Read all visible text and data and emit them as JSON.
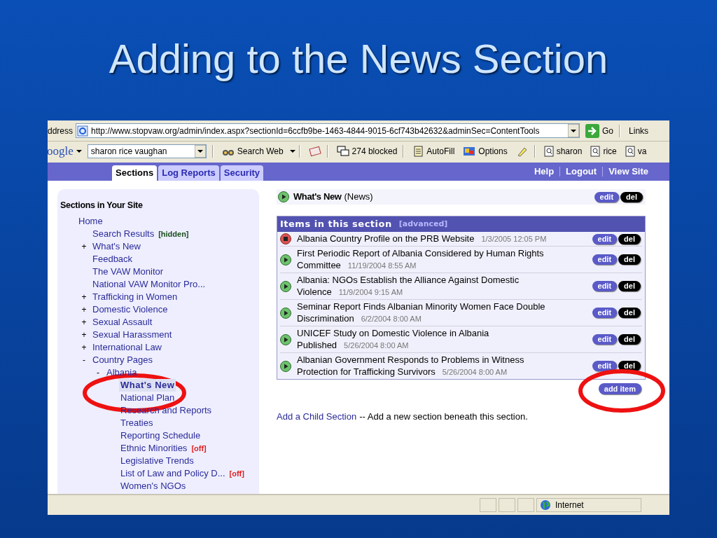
{
  "slide_title": "Adding to the News Section",
  "browser": {
    "address_label": "ddress",
    "url": "http://www.stopvaw.org/admin/index.aspx?sectionId=6ccfb9be-1463-4844-9015-6cf743b42632&adminSec=ContentTools",
    "go": "Go",
    "links": "Links",
    "toolbar": {
      "logo": "oogle",
      "search_value": "sharon rice vaughan",
      "buttons": [
        {
          "kind": "search",
          "label": "Search Web"
        },
        {
          "kind": "news"
        },
        {
          "kind": "blocked",
          "label": "274 blocked"
        },
        {
          "kind": "autofill",
          "label": "AutoFill"
        },
        {
          "kind": "options",
          "label": "Options"
        },
        {
          "kind": "highlight"
        },
        {
          "kind": "term",
          "label": "sharon"
        },
        {
          "kind": "term",
          "label": "rice"
        },
        {
          "kind": "term",
          "label": "va"
        }
      ]
    },
    "status": {
      "zone": "Internet"
    }
  },
  "nav": {
    "tabs": [
      {
        "label": "Sections",
        "selected": true
      },
      {
        "label": "Log Reports",
        "selected": false
      },
      {
        "label": "Security",
        "selected": false
      }
    ],
    "links": [
      "Help",
      "Logout",
      "View Site"
    ]
  },
  "sidebar": {
    "title": "Sections in Your Site",
    "tree": [
      {
        "label": "Home",
        "children": [
          {
            "label": "Search Results",
            "tag": {
              "text": "[hidden]",
              "color": "#1a4d1a"
            }
          },
          {
            "label": "What's New",
            "toggle": "+"
          },
          {
            "label": "Feedback"
          },
          {
            "label": "The VAW Monitor"
          },
          {
            "label": "National VAW Monitor Pro..."
          },
          {
            "label": "Trafficking in Women",
            "toggle": "+"
          },
          {
            "label": "Domestic Violence",
            "toggle": "+"
          },
          {
            "label": "Sexual Assault",
            "toggle": "+"
          },
          {
            "label": "Sexual Harassment",
            "toggle": "+"
          },
          {
            "label": "International Law",
            "toggle": "+"
          },
          {
            "label": "Country Pages",
            "toggle": "-",
            "children": [
              {
                "label": "Albania",
                "toggle": "-",
                "children": [
                  {
                    "label": "What's New",
                    "selected": true
                  },
                  {
                    "label": "National Plan",
                    "selected": false
                  },
                  {
                    "label": "Research and Reports",
                    "selected": false
                  },
                  {
                    "label": "Treaties",
                    "selected": false
                  },
                  {
                    "label": "Reporting Schedule",
                    "selected": false
                  },
                  {
                    "label": "Ethnic Minorities",
                    "selected": false,
                    "tag": {
                      "text": "[off]",
                      "color": "#e02020"
                    }
                  },
                  {
                    "label": "Legislative Trends",
                    "selected": false
                  },
                  {
                    "label": "List of Law and Policy D...",
                    "selected": false,
                    "tag": {
                      "text": "[off]",
                      "color": "#e02020"
                    }
                  },
                  {
                    "label": "Women's NGOs",
                    "selected": false
                  }
                ]
              }
            ]
          }
        ]
      }
    ]
  },
  "section": {
    "name": "What's New",
    "type": "(News)",
    "edit": "edit",
    "del": "del"
  },
  "items_panel": {
    "title": "Items in this section",
    "advanced": "[advanced]",
    "items": [
      {
        "kind": "stopped",
        "title": "Albania Country Profile on the PRB Website",
        "date": "1/3/2005 12:05 PM",
        "edit": "edit",
        "del": "del"
      },
      {
        "kind": "live",
        "title": "First Periodic Report of Albania Considered by Human Rights Committee",
        "date": "11/19/2004 8:55 AM",
        "edit": "edit",
        "del": "del"
      },
      {
        "kind": "live",
        "title": "Albania: NGOs Establish the Alliance Against Domestic Violence",
        "date": "11/9/2004 9:15 AM",
        "edit": "edit",
        "del": "del"
      },
      {
        "kind": "live",
        "title": "Seminar Report Finds Albanian Minority Women Face Double Discrimination",
        "date": "6/2/2004 8:00 AM",
        "edit": "edit",
        "del": "del"
      },
      {
        "kind": "live",
        "title": "UNICEF Study on Domestic Violence in Albania Published",
        "date": "5/26/2004 8:00 AM",
        "edit": "edit",
        "del": "del"
      },
      {
        "kind": "live",
        "title": "Albanian Government Responds to Problems in Witness Protection for Trafficking Survivors",
        "date": "5/26/2004 8:00 AM",
        "edit": "edit",
        "del": "del"
      }
    ],
    "add_item": "add item"
  },
  "child_section": {
    "link": "Add a Child Section",
    "text": "-- Add a new section beneath this section."
  }
}
